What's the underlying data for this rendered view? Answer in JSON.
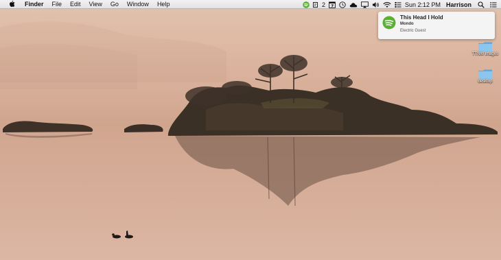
{
  "menubar": {
    "apple_icon": "apple-logo",
    "app_name": "Finder",
    "menus": [
      "File",
      "Edit",
      "View",
      "Go",
      "Window",
      "Help"
    ],
    "status_items": [
      {
        "name": "spotify-icon",
        "color": "#5ab034"
      },
      {
        "name": "adobe-creative-cloud-icon",
        "badge": "2"
      },
      {
        "name": "calendar-icon"
      },
      {
        "name": "time-machine-icon"
      },
      {
        "name": "cloud-icon"
      },
      {
        "name": "airplay-icon"
      },
      {
        "name": "volume-icon"
      },
      {
        "name": "wifi-icon"
      },
      {
        "name": "menu-extra-icon"
      }
    ],
    "clock": "Sun 2:12 PM",
    "user_name": "Harrison",
    "spotlight_icon": "search-icon",
    "notification_center_icon": "list-icon"
  },
  "notification": {
    "app_icon": "spotify-icon",
    "title": "This Head I Hold",
    "subtitle": "Mondo",
    "body": "Electric Guest",
    "accent_color": "#5ab034"
  },
  "desktop_icons": [
    {
      "icon": "folder-icon",
      "label": "TTNW images"
    },
    {
      "icon": "folder-icon",
      "label": "desktop"
    }
  ]
}
